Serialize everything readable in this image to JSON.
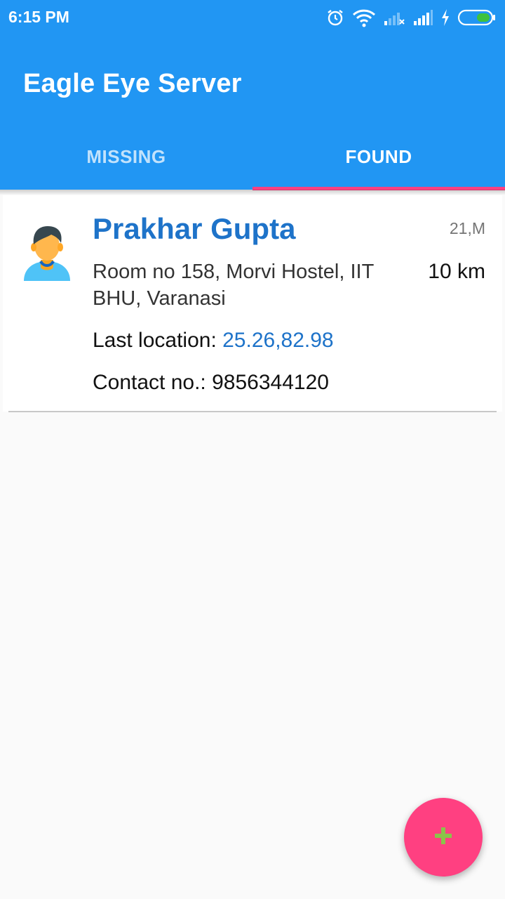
{
  "status_bar": {
    "time": "6:15 PM",
    "icons": [
      "alarm-icon",
      "wifi-icon",
      "signal-weak-icon",
      "signal-icon",
      "charging-icon",
      "battery-icon"
    ],
    "battery_color": "#3ec23e"
  },
  "app": {
    "title": "Eagle Eye Server",
    "primary_color": "#2196f3",
    "accent_color": "#ff4081"
  },
  "tabs": [
    {
      "label": "MISSING",
      "selected": false
    },
    {
      "label": "FOUND",
      "selected": true
    }
  ],
  "found_list": [
    {
      "name": "Prakhar Gupta",
      "age_sex": "21,M",
      "address": "Room no 158, Morvi Hostel, IIT BHU, Varanasi",
      "distance": "10 km",
      "last_location_label": "Last location: ",
      "last_location_value": "25.26,82.98",
      "contact_label": "Contact no.: ",
      "contact_value": "9856344120",
      "avatar_icon": "person-avatar-icon"
    }
  ],
  "fab": {
    "icon": "plus-icon",
    "icon_color": "#8bc34a"
  }
}
